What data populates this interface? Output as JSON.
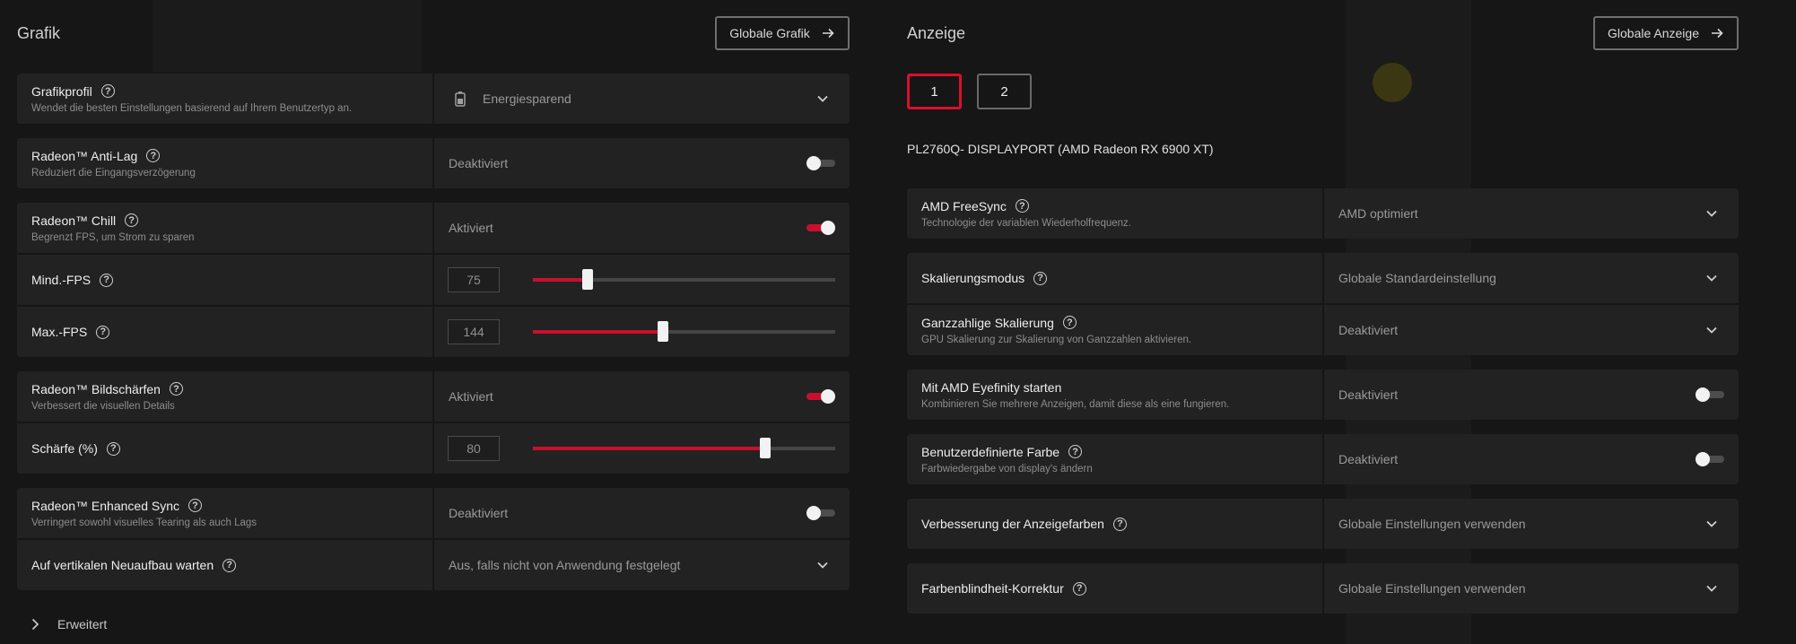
{
  "graphics": {
    "title": "Grafik",
    "global_button": "Globale Grafik",
    "profile": {
      "label": "Grafikprofil",
      "desc": "Wendet die besten Einstellungen basierend auf Ihrem Benutzertyp an.",
      "value": "Energiesparend"
    },
    "anti_lag": {
      "label": "Radeon™ Anti-Lag",
      "desc": "Reduziert die Eingangsverzögerung",
      "value": "Deaktiviert",
      "enabled": false
    },
    "chill": {
      "label": "Radeon™ Chill",
      "desc": "Begrenzt FPS, um Strom zu sparen",
      "value": "Aktiviert",
      "enabled": true,
      "min_fps": {
        "label": "Mind.-FPS",
        "value": "75",
        "fraction": 0.18
      },
      "max_fps": {
        "label": "Max.-FPS",
        "value": "144",
        "fraction": 0.43
      }
    },
    "sharpening": {
      "label": "Radeon™ Bildschärfen",
      "desc": "Verbessert die visuellen Details",
      "value": "Aktiviert",
      "enabled": true,
      "sharpness": {
        "label": "Schärfe (%)",
        "value": "80",
        "fraction": 0.77
      }
    },
    "enhanced_sync": {
      "label": "Radeon™ Enhanced Sync",
      "desc": "Verringert sowohl visuelles Tearing als auch Lags",
      "value": "Deaktiviert",
      "enabled": false
    },
    "vsync": {
      "label": "Auf vertikalen Neuaufbau warten",
      "value": "Aus, falls nicht von Anwendung festgelegt"
    },
    "advanced": "Erweitert"
  },
  "display": {
    "title": "Anzeige",
    "global_button": "Globale Anzeige",
    "displays": [
      "1",
      "2"
    ],
    "monitor_name": "PL2760Q- DISPLAYPORT (AMD Radeon RX 6900 XT)",
    "freesync": {
      "label": "AMD FreeSync",
      "desc": "Technologie der variablen Wiederholfrequenz.",
      "value": "AMD optimiert"
    },
    "scaling_mode": {
      "label": "Skalierungsmodus",
      "value": "Globale Standardeinstellung"
    },
    "integer_scaling": {
      "label": "Ganzzahlige Skalierung",
      "desc": "GPU Skalierung zur Skalierung von Ganzzahlen aktivieren.",
      "value": "Deaktiviert"
    },
    "eyefinity": {
      "label": "Mit AMD Eyefinity starten",
      "desc": "Kombinieren Sie mehrere Anzeigen, damit diese als eine fungieren.",
      "value": "Deaktiviert",
      "enabled": false
    },
    "custom_color": {
      "label": "Benutzerdefinierte Farbe",
      "desc": "Farbwiedergabe von display's ändern",
      "value": "Deaktiviert",
      "enabled": false
    },
    "color_enhancement": {
      "label": "Verbesserung der Anzeigefarben",
      "value": "Globale Einstellungen verwenden"
    },
    "color_blindness": {
      "label": "Farbenblindheit-Korrektur",
      "value": "Globale Einstellungen verwenden"
    }
  },
  "colors": {
    "accent": "#c8102e",
    "panel": "#222222",
    "background": "#161616"
  }
}
